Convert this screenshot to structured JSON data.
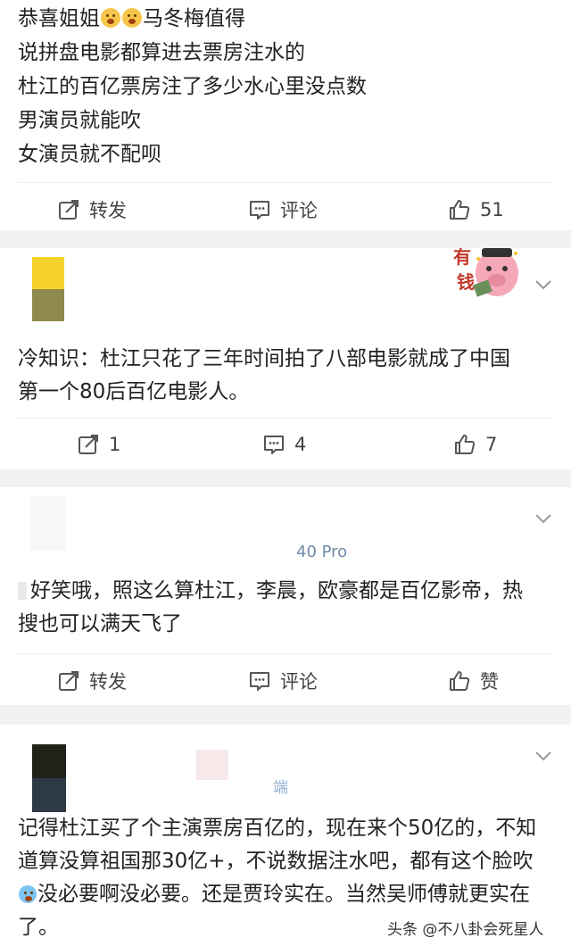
{
  "posts": [
    {
      "lines": [
        "恭喜姐姐",
        "马冬梅值得",
        "说拼盘电影都算进去票房注水的",
        "杜江的百亿票房注了多少水心里没点数",
        "男演员就能吹",
        "女演员就不配呗"
      ],
      "repost_label": "转发",
      "comment_label": "评论",
      "like_count": "51"
    },
    {
      "sticker_text": [
        "有",
        "钱"
      ],
      "lines": [
        "冷知识：杜江只花了三年时间拍了八部电影就成了中国",
        "第一个80后百亿电影人。"
      ],
      "repost_count": "1",
      "comment_count": "4",
      "like_count": "7"
    },
    {
      "device": "40 Pro",
      "lines": [
        "好笑哦，照这么算杜江，李晨，欧豪都是百亿影帝，热",
        "搜也可以满天飞了"
      ],
      "repost_label": "转发",
      "comment_label": "评论",
      "like_label": "赞"
    },
    {
      "device_fragment": "端",
      "lines": [
        "记得杜江买了个主演票房百亿的，现在来个50亿的，不知",
        "道算没算祖国那30亿+，不说数据注水吧，都有这个脸吹",
        "没必要啊没必要。还是贾玲实在。当然吴师傅就更实在",
        "了。"
      ]
    }
  ],
  "watermark": "头条 @不八卦会死星人",
  "colors": {
    "separator": "#f1f1f1",
    "text": "#222222",
    "action_text": "#444444"
  }
}
